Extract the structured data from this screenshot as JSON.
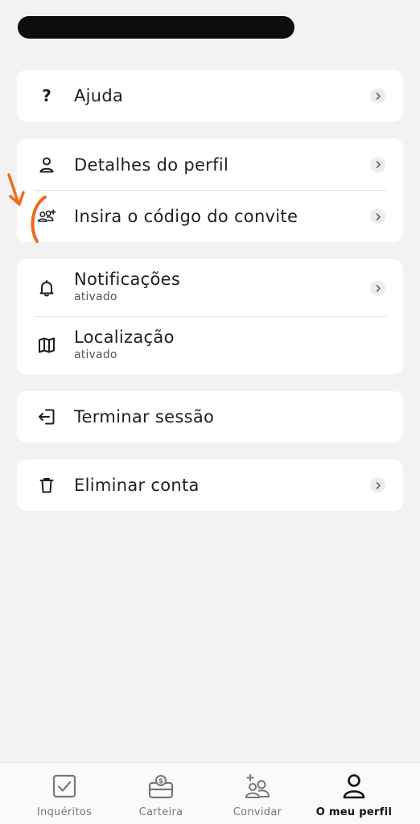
{
  "menu": {
    "help": {
      "label": "Ajuda",
      "icon": "question-mark-icon"
    },
    "profile_details": {
      "label": "Detalhes do perfil",
      "icon": "person-icon"
    },
    "invite_code": {
      "label": "Insira o código do convite",
      "icon": "people-add-icon"
    },
    "notifications": {
      "label": "Notificações",
      "status": "ativado",
      "icon": "bell-icon"
    },
    "location": {
      "label": "Localização",
      "status": "ativado",
      "icon": "map-icon"
    },
    "logout": {
      "label": "Terminar sessão",
      "icon": "logout-icon"
    },
    "delete_account": {
      "label": "Eliminar conta",
      "icon": "trash-icon"
    }
  },
  "tabs": [
    {
      "label": "Inquéritos",
      "icon": "checkbox-icon",
      "active": false
    },
    {
      "label": "Carteira",
      "icon": "wallet-icon",
      "active": false
    },
    {
      "label": "Convidar",
      "icon": "invite-people-icon",
      "active": false
    },
    {
      "label": "O meu perfil",
      "icon": "person-icon",
      "active": true
    }
  ],
  "colors": {
    "background": "#f2f2f2",
    "card": "#ffffff",
    "annotation": "#f06a1d",
    "text": "#1f1f1f"
  }
}
